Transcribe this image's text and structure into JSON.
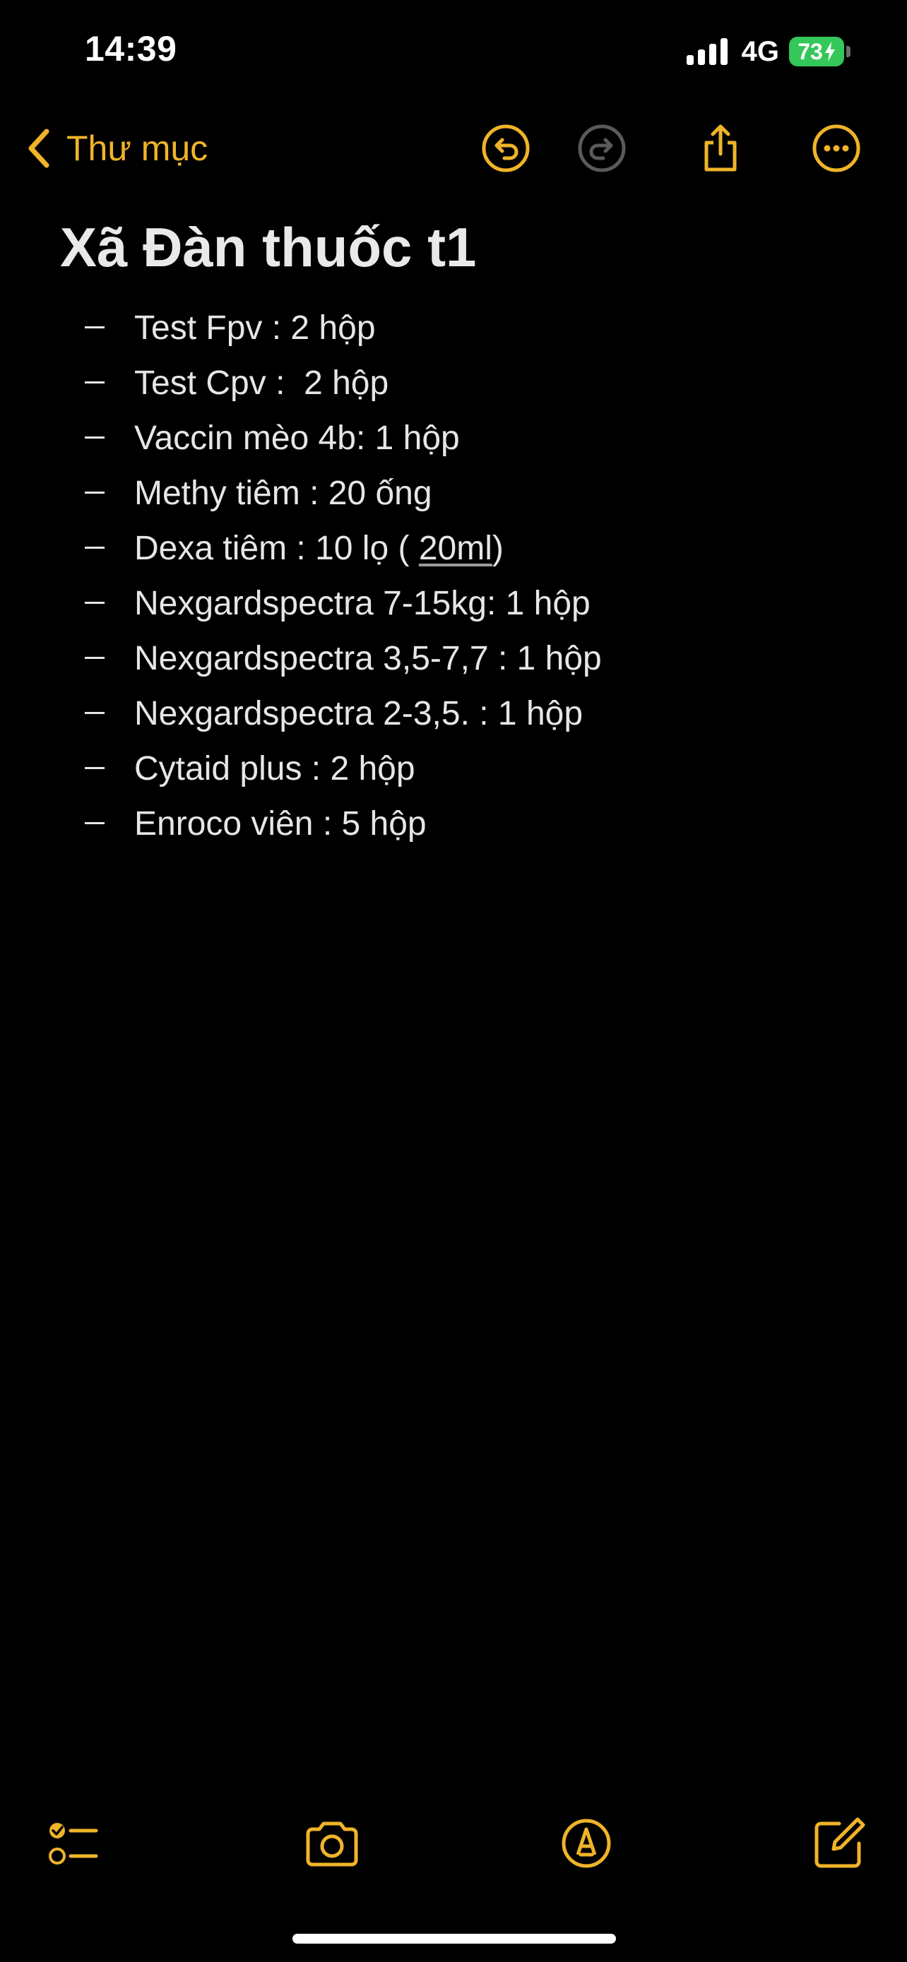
{
  "status_bar": {
    "time": "14:39",
    "network": "4G",
    "battery": "73",
    "battery_color": "#34c759"
  },
  "nav": {
    "back_label": "Thư mục",
    "accent_color": "#f0b429",
    "icons": [
      "chevron-left-icon",
      "undo-icon",
      "redo-icon",
      "share-icon",
      "more-icon"
    ]
  },
  "note": {
    "title": "Xã Đàn thuốc t1",
    "items": [
      {
        "text": "Test Fpv : 2 hộp"
      },
      {
        "text": "Test Cpv :  2 hộp"
      },
      {
        "text": "Vaccin mèo 4b: 1 hộp"
      },
      {
        "text": "Methy tiêm : 20 ống"
      },
      {
        "text_before": "Dexa tiêm : 10 lọ ( ",
        "text_underlined": "20ml",
        "text_after": ")"
      },
      {
        "text": "Nexgardspectra 7-15kg: 1 hộp"
      },
      {
        "text": "Nexgardspectra 3,5-7,7 : 1 hộp"
      },
      {
        "text": "Nexgardspectra 2-3,5. : 1 hộp"
      },
      {
        "text": "Cytaid plus : 2 hộp"
      },
      {
        "text": "Enroco viên : 5 hộp"
      }
    ]
  },
  "toolbar": {
    "icons": [
      "checklist-icon",
      "camera-icon",
      "markup-icon",
      "compose-icon"
    ]
  }
}
